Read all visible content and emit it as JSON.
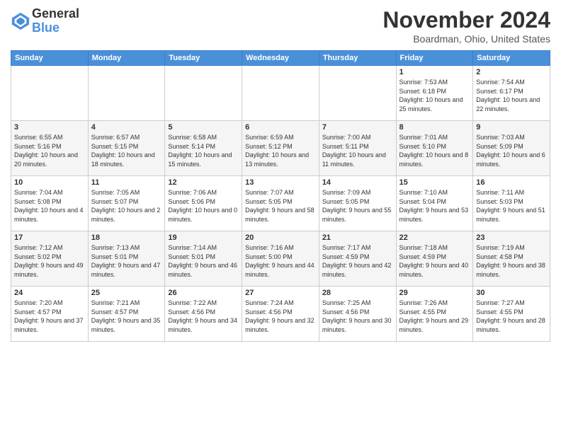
{
  "header": {
    "logo_line1": "General",
    "logo_line2": "Blue",
    "month_title": "November 2024",
    "location": "Boardman, Ohio, United States"
  },
  "weekdays": [
    "Sunday",
    "Monday",
    "Tuesday",
    "Wednesday",
    "Thursday",
    "Friday",
    "Saturday"
  ],
  "weeks": [
    [
      {
        "day": "",
        "info": ""
      },
      {
        "day": "",
        "info": ""
      },
      {
        "day": "",
        "info": ""
      },
      {
        "day": "",
        "info": ""
      },
      {
        "day": "",
        "info": ""
      },
      {
        "day": "1",
        "info": "Sunrise: 7:53 AM\nSunset: 6:18 PM\nDaylight: 10 hours and 25 minutes."
      },
      {
        "day": "2",
        "info": "Sunrise: 7:54 AM\nSunset: 6:17 PM\nDaylight: 10 hours and 22 minutes."
      }
    ],
    [
      {
        "day": "3",
        "info": "Sunrise: 6:55 AM\nSunset: 5:16 PM\nDaylight: 10 hours and 20 minutes."
      },
      {
        "day": "4",
        "info": "Sunrise: 6:57 AM\nSunset: 5:15 PM\nDaylight: 10 hours and 18 minutes."
      },
      {
        "day": "5",
        "info": "Sunrise: 6:58 AM\nSunset: 5:14 PM\nDaylight: 10 hours and 15 minutes."
      },
      {
        "day": "6",
        "info": "Sunrise: 6:59 AM\nSunset: 5:12 PM\nDaylight: 10 hours and 13 minutes."
      },
      {
        "day": "7",
        "info": "Sunrise: 7:00 AM\nSunset: 5:11 PM\nDaylight: 10 hours and 11 minutes."
      },
      {
        "day": "8",
        "info": "Sunrise: 7:01 AM\nSunset: 5:10 PM\nDaylight: 10 hours and 8 minutes."
      },
      {
        "day": "9",
        "info": "Sunrise: 7:03 AM\nSunset: 5:09 PM\nDaylight: 10 hours and 6 minutes."
      }
    ],
    [
      {
        "day": "10",
        "info": "Sunrise: 7:04 AM\nSunset: 5:08 PM\nDaylight: 10 hours and 4 minutes."
      },
      {
        "day": "11",
        "info": "Sunrise: 7:05 AM\nSunset: 5:07 PM\nDaylight: 10 hours and 2 minutes."
      },
      {
        "day": "12",
        "info": "Sunrise: 7:06 AM\nSunset: 5:06 PM\nDaylight: 10 hours and 0 minutes."
      },
      {
        "day": "13",
        "info": "Sunrise: 7:07 AM\nSunset: 5:05 PM\nDaylight: 9 hours and 58 minutes."
      },
      {
        "day": "14",
        "info": "Sunrise: 7:09 AM\nSunset: 5:05 PM\nDaylight: 9 hours and 55 minutes."
      },
      {
        "day": "15",
        "info": "Sunrise: 7:10 AM\nSunset: 5:04 PM\nDaylight: 9 hours and 53 minutes."
      },
      {
        "day": "16",
        "info": "Sunrise: 7:11 AM\nSunset: 5:03 PM\nDaylight: 9 hours and 51 minutes."
      }
    ],
    [
      {
        "day": "17",
        "info": "Sunrise: 7:12 AM\nSunset: 5:02 PM\nDaylight: 9 hours and 49 minutes."
      },
      {
        "day": "18",
        "info": "Sunrise: 7:13 AM\nSunset: 5:01 PM\nDaylight: 9 hours and 47 minutes."
      },
      {
        "day": "19",
        "info": "Sunrise: 7:14 AM\nSunset: 5:01 PM\nDaylight: 9 hours and 46 minutes."
      },
      {
        "day": "20",
        "info": "Sunrise: 7:16 AM\nSunset: 5:00 PM\nDaylight: 9 hours and 44 minutes."
      },
      {
        "day": "21",
        "info": "Sunrise: 7:17 AM\nSunset: 4:59 PM\nDaylight: 9 hours and 42 minutes."
      },
      {
        "day": "22",
        "info": "Sunrise: 7:18 AM\nSunset: 4:59 PM\nDaylight: 9 hours and 40 minutes."
      },
      {
        "day": "23",
        "info": "Sunrise: 7:19 AM\nSunset: 4:58 PM\nDaylight: 9 hours and 38 minutes."
      }
    ],
    [
      {
        "day": "24",
        "info": "Sunrise: 7:20 AM\nSunset: 4:57 PM\nDaylight: 9 hours and 37 minutes."
      },
      {
        "day": "25",
        "info": "Sunrise: 7:21 AM\nSunset: 4:57 PM\nDaylight: 9 hours and 35 minutes."
      },
      {
        "day": "26",
        "info": "Sunrise: 7:22 AM\nSunset: 4:56 PM\nDaylight: 9 hours and 34 minutes."
      },
      {
        "day": "27",
        "info": "Sunrise: 7:24 AM\nSunset: 4:56 PM\nDaylight: 9 hours and 32 minutes."
      },
      {
        "day": "28",
        "info": "Sunrise: 7:25 AM\nSunset: 4:56 PM\nDaylight: 9 hours and 30 minutes."
      },
      {
        "day": "29",
        "info": "Sunrise: 7:26 AM\nSunset: 4:55 PM\nDaylight: 9 hours and 29 minutes."
      },
      {
        "day": "30",
        "info": "Sunrise: 7:27 AM\nSunset: 4:55 PM\nDaylight: 9 hours and 28 minutes."
      }
    ]
  ]
}
